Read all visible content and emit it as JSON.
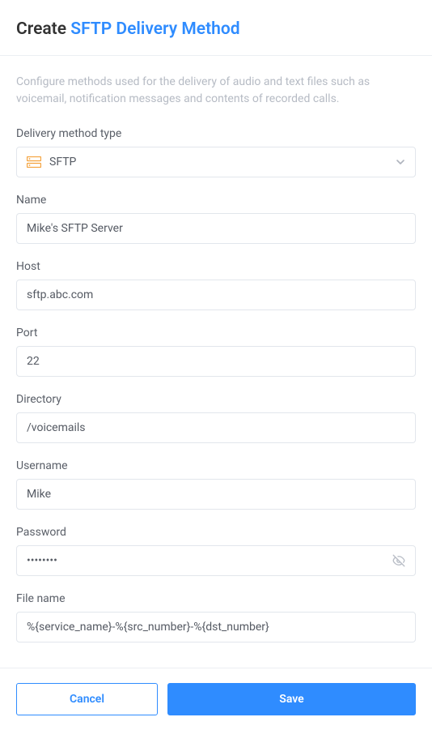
{
  "title": {
    "prefix": "Create",
    "highlight": "SFTP Delivery Method"
  },
  "description": "Configure methods used for the delivery of audio and text files such as voicemail, notification messages and contents of recorded calls.",
  "form": {
    "deliveryMethodType": {
      "label": "Delivery method type",
      "value": "SFTP",
      "icon": "server-icon"
    },
    "name": {
      "label": "Name",
      "value": "Mike's SFTP Server"
    },
    "host": {
      "label": "Host",
      "value": "sftp.abc.com"
    },
    "port": {
      "label": "Port",
      "value": "22"
    },
    "directory": {
      "label": "Directory",
      "value": "/voicemails"
    },
    "username": {
      "label": "Username",
      "value": "Mike"
    },
    "password": {
      "label": "Password",
      "value": "••••••••"
    },
    "filename": {
      "label": "File name",
      "value": "%{service_name}-%{src_number}-%{dst_number}"
    }
  },
  "buttons": {
    "cancel": "Cancel",
    "save": "Save"
  }
}
